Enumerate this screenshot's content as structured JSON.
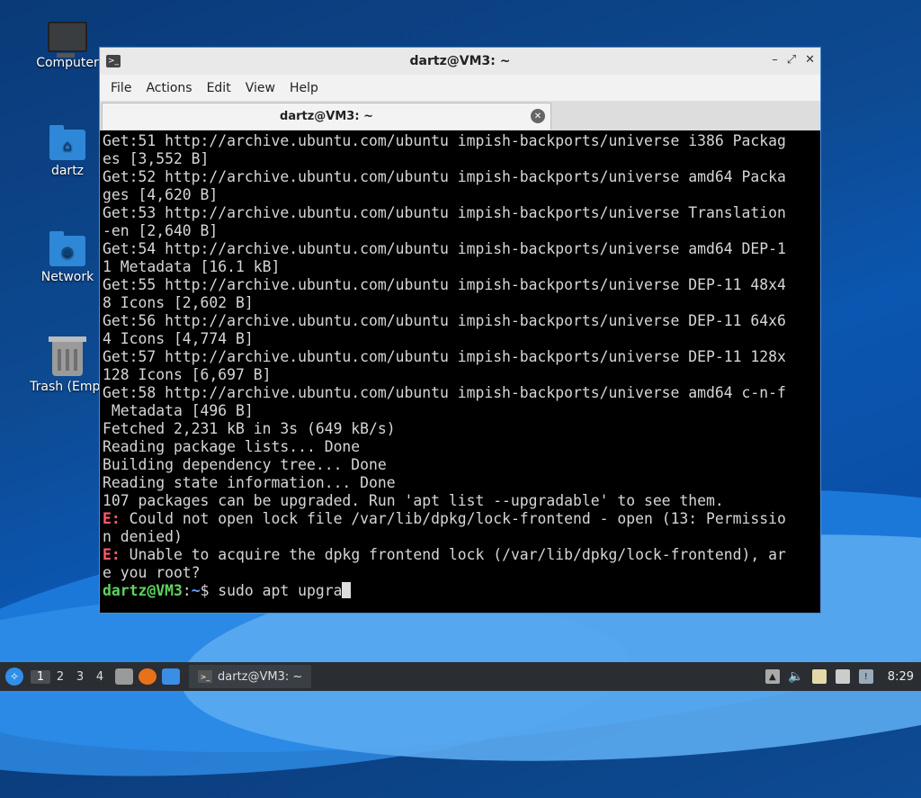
{
  "desktop": {
    "icons": [
      {
        "label": "Computer",
        "icon": "computer-icon"
      },
      {
        "label": "dartz",
        "icon": "home-folder-icon"
      },
      {
        "label": "Network",
        "icon": "network-folder-icon"
      },
      {
        "label": "Trash (Empt",
        "icon": "trash-icon"
      }
    ]
  },
  "window": {
    "title": "dartz@VM3: ~",
    "menu": [
      "File",
      "Actions",
      "Edit",
      "View",
      "Help"
    ],
    "tab_title": "dartz@VM3: ~",
    "terminal_lines": [
      "Get:51 http://archive.ubuntu.com/ubuntu impish-backports/universe i386 Packag",
      "es [3,552 B]",
      "Get:52 http://archive.ubuntu.com/ubuntu impish-backports/universe amd64 Packa",
      "ges [4,620 B]",
      "Get:53 http://archive.ubuntu.com/ubuntu impish-backports/universe Translation",
      "-en [2,640 B]",
      "Get:54 http://archive.ubuntu.com/ubuntu impish-backports/universe amd64 DEP-1",
      "1 Metadata [16.1 kB]",
      "Get:55 http://archive.ubuntu.com/ubuntu impish-backports/universe DEP-11 48x4",
      "8 Icons [2,602 B]",
      "Get:56 http://archive.ubuntu.com/ubuntu impish-backports/universe DEP-11 64x6",
      "4 Icons [4,774 B]",
      "Get:57 http://archive.ubuntu.com/ubuntu impish-backports/universe DEP-11 128x",
      "128 Icons [6,697 B]",
      "Get:58 http://archive.ubuntu.com/ubuntu impish-backports/universe amd64 c-n-f",
      " Metadata [496 B]",
      "Fetched 2,231 kB in 3s (649 kB/s)",
      "Reading package lists... Done",
      "Building dependency tree... Done",
      "Reading state information... Done",
      "107 packages can be upgraded. Run 'apt list --upgradable' to see them."
    ],
    "errors": [
      {
        "prefix": "E:",
        "line1": " Could not open lock file /var/lib/dpkg/lock-frontend - open (13: Permissio",
        "line2": "n denied)"
      },
      {
        "prefix": "E:",
        "line1": " Unable to acquire the dpkg frontend lock (/var/lib/dpkg/lock-frontend), ar",
        "line2": "e you root?"
      }
    ],
    "prompt": {
      "user_host": "dartz@VM3",
      "sep": ":",
      "path": "~",
      "symbol": "$",
      "command": " sudo apt upgra"
    }
  },
  "taskbar": {
    "workspaces": [
      "1",
      "2",
      "3",
      "4"
    ],
    "task_label": "dartz@VM3: ~",
    "clock": "8:29"
  }
}
